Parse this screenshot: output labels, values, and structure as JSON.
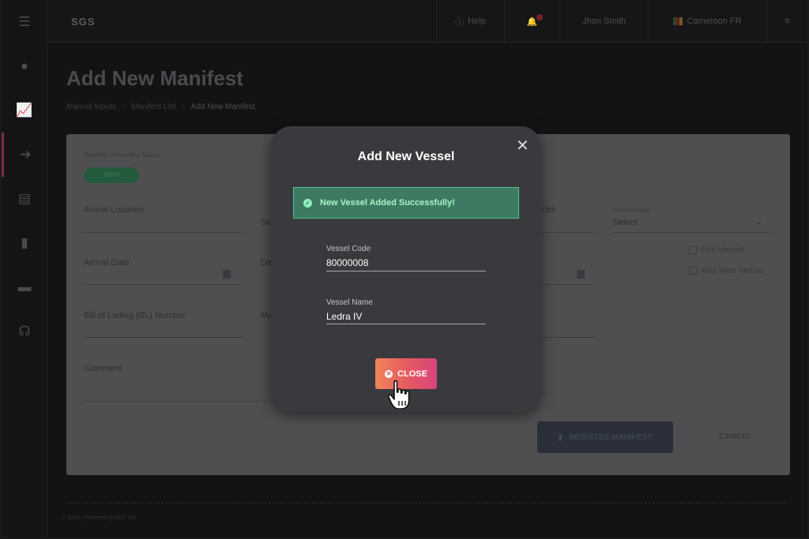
{
  "app": {
    "logo": "SGS"
  },
  "topbar": {
    "help": "Help",
    "user": "Jhon Smith",
    "location": "Cameroon FR"
  },
  "sidebar": {
    "icons": [
      "menu-icon",
      "globe-icon",
      "chart-icon",
      "import-icon",
      "inbox-icon",
      "document-icon",
      "card-icon",
      "support-icon"
    ]
  },
  "page": {
    "title": "Add New Manifest",
    "breadcrumb": [
      "Manual Inputs",
      "Manifest List",
      "Add New Manifest"
    ]
  },
  "form": {
    "status_label": "Manifest / Vesseling Status",
    "status_value": "New",
    "arrival_location": "Arrival Location",
    "select_short": "Se",
    "packs": "acks",
    "vessel_name_label": "Vessel Name",
    "vessel_select": "Select",
    "arrival_date": "Arrival Date",
    "de": "De",
    "edit_vessel": "Edit Vessel",
    "add_new_vessel": "Add New Vessel",
    "bl_number": "Bill of Lading (BL) Number",
    "ma": "Ma",
    "comment": "Comment",
    "register_button": "REGISTER MANIFEST",
    "cancel_button": "CANCEL"
  },
  "footer": {
    "text": "© 2023 | Powered by SGS SA"
  },
  "modal": {
    "title": "Add New Vessel",
    "alert": "New Vessel Added Successfully!",
    "vessel_code_label": "Vessel Code",
    "vessel_code": "80000008",
    "vessel_name_label": "Vessel Name",
    "vessel_name": "Ledra IV",
    "close_button": "CLOSE"
  },
  "colors": {
    "success": "#4cc38e",
    "button_start": "#f0845a",
    "button_end": "#d8447a"
  }
}
